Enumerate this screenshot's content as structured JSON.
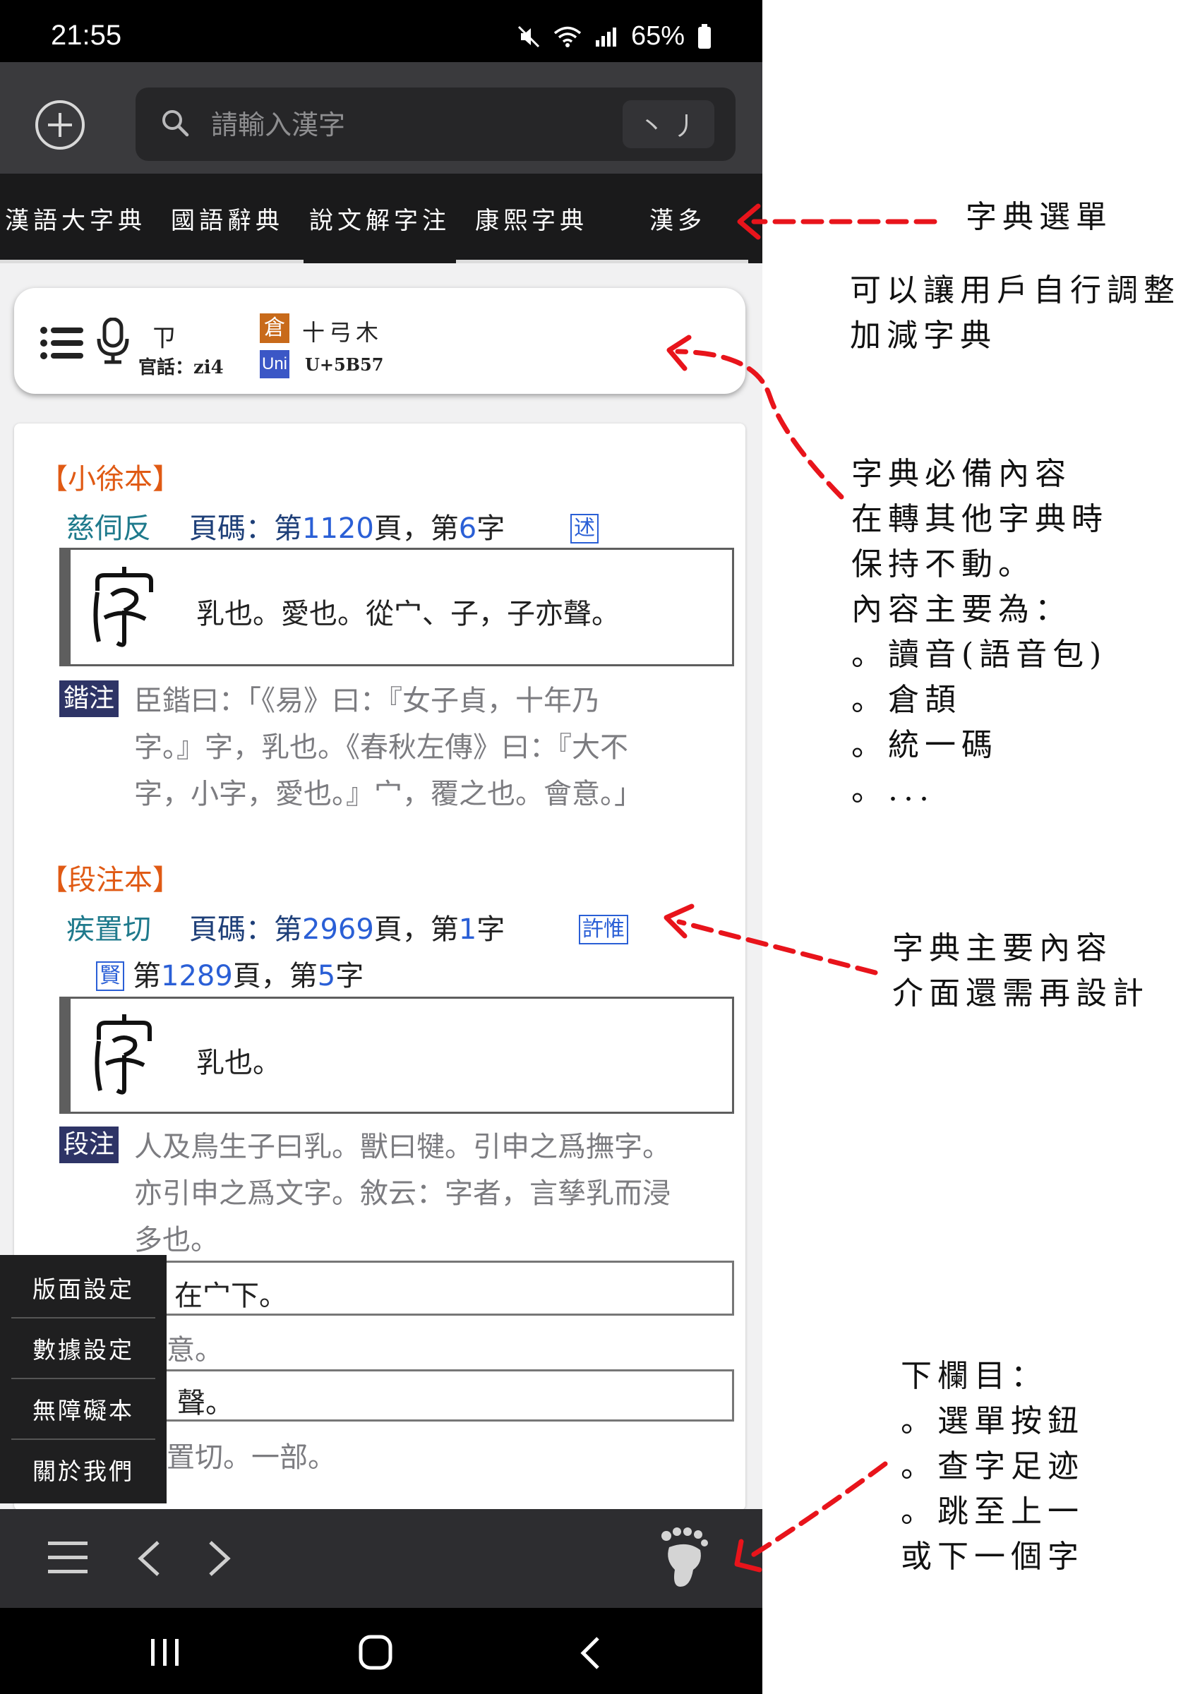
{
  "status_bar": {
    "time": "21:55",
    "battery": "65%"
  },
  "search": {
    "placeholder": "請輸入漢字",
    "handwrite_label": "丶 丿"
  },
  "dictionary_tabs": [
    {
      "label": "漢語大字典"
    },
    {
      "label": "國語辭典"
    },
    {
      "label": "說文解字注"
    },
    {
      "label": "康熙字典"
    },
    {
      "label": "漢多"
    }
  ],
  "header_card": {
    "zhuyin": "ㄗ",
    "pinyin": "官話：zi4",
    "cangjie_label": "倉",
    "cangjie_code": "十弓木",
    "unicode_label": "Uni",
    "unicode_code": "U+5B57"
  },
  "content": {
    "xiaoxu": {
      "heading": "【小徐本】",
      "fanqie": "慈伺反",
      "page_prefix": "頁碼：第",
      "page_num": "1120",
      "page_mid": "頁，第",
      "char_num": "6",
      "char_suffix": "字",
      "badge": "述",
      "definition": "乳也。愛也。從宀、子，子亦聲。",
      "note_tag": "鍇注",
      "note_lines": [
        "臣鍇曰：「《易》曰：『女子貞，十年乃",
        "字。』字，乳也。《春秋左傳》曰：『大不",
        "字，小字，愛也。』宀，覆之也。會意。」"
      ]
    },
    "duanzhu": {
      "heading": "【段注本】",
      "fanqie": "疾置切",
      "page_prefix": "頁碼：第",
      "page_num": "2969",
      "page_mid": "頁，第",
      "char_num": "1",
      "char_suffix": "字",
      "badge": "許惟",
      "badge2": "賢",
      "page2_prefix": "第",
      "page2_num": "1289",
      "page2_mid": "頁，第",
      "char2_num": "5",
      "char2_suffix": "字",
      "definition": "乳也。",
      "note_tag": "段注",
      "note_lines": [
        "人及鳥生子曰乳。獸曰犍。引申之爲撫字。",
        "亦引申之爲文字。敘云：字者，言孳乳而浸",
        "多也。"
      ],
      "box2_text": "在宀下。",
      "line_after_box2": "意。",
      "box3_text": "聲。",
      "last_line": "置切。一部。"
    }
  },
  "side_menu": [
    {
      "label": "版面設定"
    },
    {
      "label": "數據設定"
    },
    {
      "label": "無障礙本"
    },
    {
      "label": "關於我們"
    }
  ],
  "annotations": [
    {
      "text": "字典選單"
    },
    {
      "text": "可以讓用戶自行調整\n加減字典"
    },
    {
      "text": "字典必備內容\n在轉其他字典時\n保持不動。\n內容主要為：\n。讀音(語音包)\n。倉頡\n。統一碼\n。..."
    },
    {
      "text": "字典主要內容\n介面還需再設計"
    },
    {
      "text": "下欄目：\n。選單按鈕\n。查字足迹\n。跳至上一\n或下一個字"
    }
  ],
  "colors": {
    "accent_orange": "#e05a14",
    "teal": "#1f7a8c",
    "page_blue": "#2a5fd6",
    "tag_navy": "#2e3466",
    "arrow_red": "#e8141b"
  }
}
